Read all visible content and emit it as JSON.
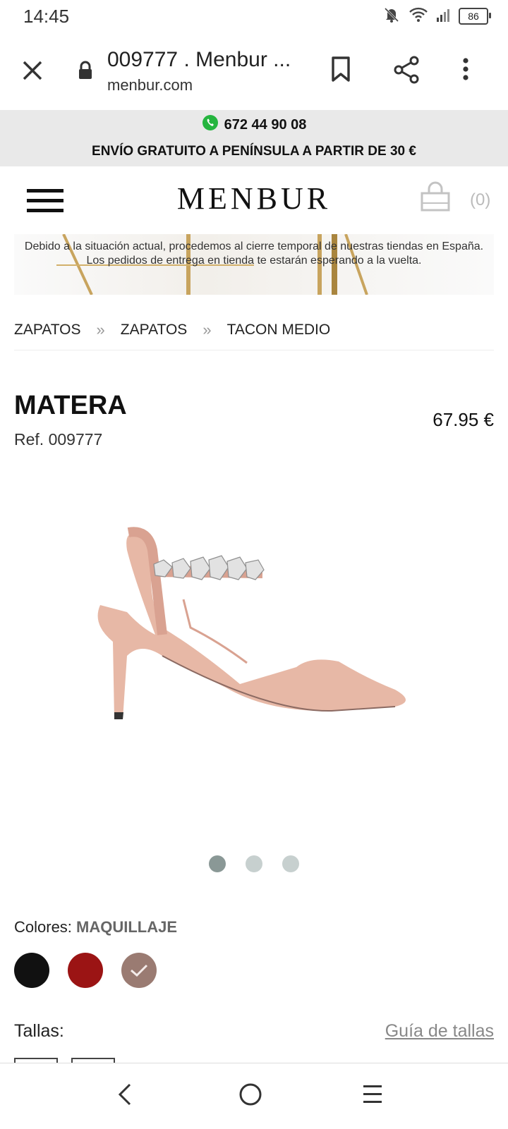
{
  "status": {
    "time": "14:45",
    "battery": "86"
  },
  "browser": {
    "title": "009777 . Menbur ...",
    "domain": "menbur.com"
  },
  "promo": {
    "phone": "672 44 90 08",
    "shipping": "ENVÍO GRATUITO A PENÍNSULA A PARTIR DE 30 €"
  },
  "header": {
    "logo": "MENBUR",
    "cart_count": "(0)"
  },
  "notice": {
    "text": "Debido a la situación actual, procedemos al cierre temporal de nuestras tiendas en España. Los pedidos de entrega en tienda te estarán esperando a la vuelta."
  },
  "breadcrumb": {
    "items": [
      "ZAPATOS",
      "ZAPATOS",
      "TACON MEDIO"
    ],
    "separator": "»"
  },
  "product": {
    "name": "MATERA",
    "ref": "Ref. 009777",
    "price": "67.95 €"
  },
  "gallery": {
    "count": 3,
    "active_index": 0
  },
  "colors": {
    "label": "Colores:",
    "selected_name": "MAQUILLAJE",
    "swatches": [
      {
        "color": "#111111",
        "selected": false
      },
      {
        "color": "#9b1414",
        "selected": false
      },
      {
        "color": "#9a7b72",
        "selected": true
      }
    ]
  },
  "sizes": {
    "label": "Tallas:",
    "guide_link": "Guía de tallas"
  }
}
